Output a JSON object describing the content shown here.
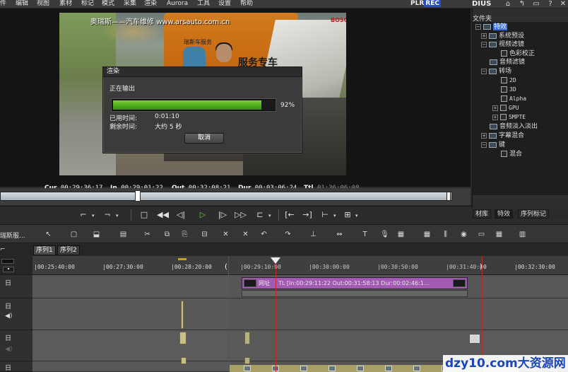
{
  "menu": [
    "件",
    "编辑",
    "视图",
    "素材",
    "标记",
    "模式",
    "采集",
    "渲染",
    "Aurora",
    "工具",
    "设置",
    "帮助"
  ],
  "recorder": {
    "plr": "PLR",
    "rec": "REC"
  },
  "brand": "DIUS",
  "video": {
    "watermark": "奥瑞斯——汽车维修",
    "url": "www.arsauto.com.cn",
    "plate": "服务专车",
    "sign": "BOSCH",
    "shirt": "瑞斯车服务"
  },
  "render_dialog": {
    "title": "渲染",
    "status": "正在输出",
    "progress_label": "92%",
    "progress": 0.92,
    "elapsed_label": "已用时间:",
    "elapsed_value": "0:01:10",
    "remaining_label": "剩余时间:",
    "remaining_value": "大约 5 秒",
    "cancel": "取消"
  },
  "timecodes": {
    "cur_label": "Cur",
    "cur": "00:29:36:17",
    "in_label": "In",
    "in": "00:29:01:22",
    "out_label": "Out",
    "out": "00:32:08:21",
    "dur_label": "Dur",
    "dur": "00:03:06:24",
    "ttl_label": "Ttl",
    "ttl": "01:36:06:08"
  },
  "scrubber_position": 0.3,
  "effects_panel": {
    "title": "文件夹",
    "tree": [
      {
        "label": "特效",
        "selected": true
      },
      {
        "label": "系统预设"
      },
      {
        "label": "视频滤镜"
      },
      {
        "label": "色彩校正"
      },
      {
        "label": "音频滤镜"
      },
      {
        "label": "转场"
      },
      {
        "label": "2D"
      },
      {
        "label": "3D"
      },
      {
        "label": "Alpha"
      },
      {
        "label": "GPU"
      },
      {
        "label": "SMPTE"
      },
      {
        "label": "音频淡入淡出"
      },
      {
        "label": "字幕混合"
      },
      {
        "label": "键"
      },
      {
        "label": "混合"
      }
    ],
    "tabs": [
      "材库",
      "特效",
      "序列标记"
    ]
  },
  "timeline": {
    "project_name": "瑞斯服...",
    "sequences": [
      "序列1",
      "序列2"
    ],
    "ruler": [
      "|00:25:40:00",
      "|00:27:30:00",
      "|00:28:20:00",
      "|00:29:10:00",
      "|00:30:00:00",
      "|00:30:50:00",
      "|00:31:40:00",
      "|00:32:30:00"
    ],
    "title_clip_name": "网址",
    "title_clip_info": "TL [In:00:29:11:22 Out:00:31:58:13 Dur:00:02:46:1..."
  },
  "site_watermark": "dzy10.com大资源网",
  "colors": {
    "progress": "#4caa1c",
    "title_clip": "#b15cc4",
    "playhead": "#c02a2a",
    "rec": "#2a4fb8"
  }
}
